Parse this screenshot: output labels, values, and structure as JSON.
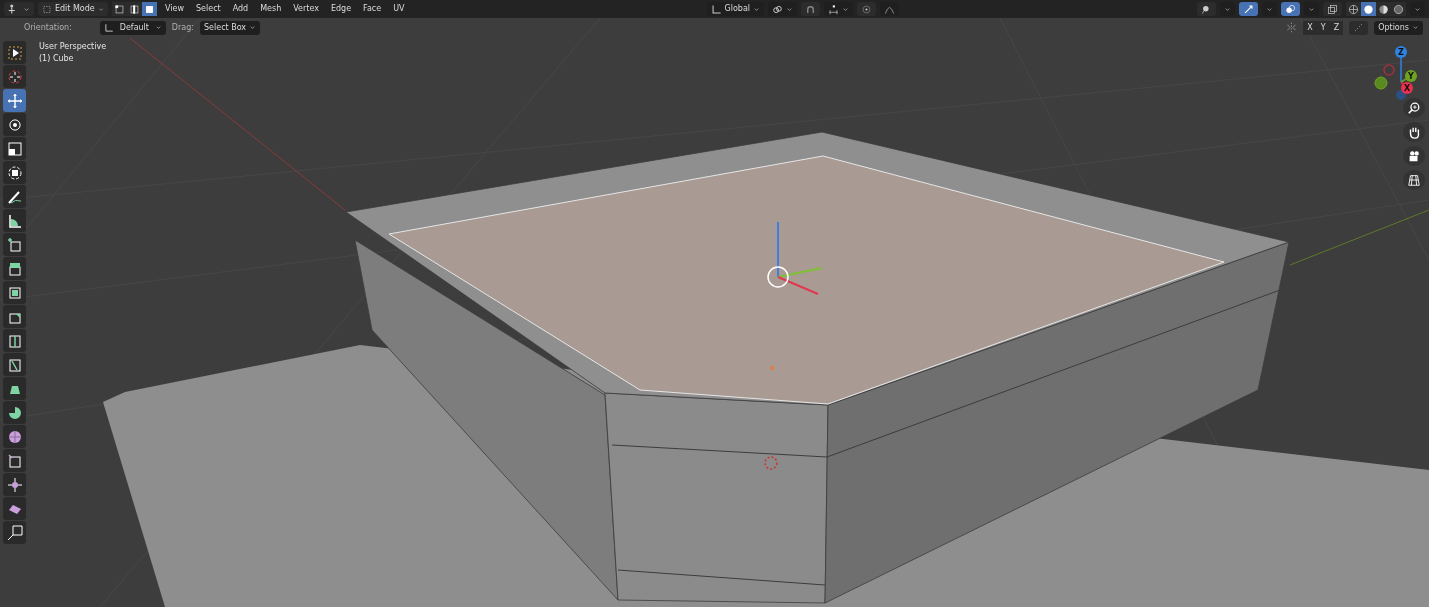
{
  "header": {
    "mode": "Edit Mode",
    "select_modes": [
      {
        "kind": "vertex",
        "selected": false
      },
      {
        "kind": "edge",
        "selected": false
      },
      {
        "kind": "face",
        "selected": true
      }
    ],
    "menus": [
      "View",
      "Select",
      "Add",
      "Mesh",
      "Vertex",
      "Edge",
      "Face",
      "UV"
    ],
    "orientation": "Global",
    "toggles": [
      {
        "kind": "visibility",
        "selected": false
      },
      {
        "kind": "gizmo",
        "selected": true
      },
      {
        "kind": "overlay",
        "selected": true
      },
      {
        "kind": "xray",
        "selected": false
      }
    ],
    "shading_modes": [
      {
        "kind": "wireframe",
        "selected": false
      },
      {
        "kind": "solid",
        "selected": true
      },
      {
        "kind": "material",
        "selected": false
      },
      {
        "kind": "rendered",
        "selected": false
      }
    ]
  },
  "tool_settings": {
    "orientation_label": "Orientation:",
    "orientation": "Default",
    "drag_label": "Drag:",
    "drag": "Select Box",
    "mirror_axes": [
      "X",
      "Y",
      "Z"
    ],
    "options": "Options"
  },
  "viewport": {
    "view_name": "User Perspective",
    "object_name": "(1) Cube"
  },
  "toolbar": [
    {
      "kind": "select",
      "selected": false
    },
    {
      "kind": "cursor",
      "selected": false
    },
    {
      "kind": "move",
      "selected": true
    },
    {
      "kind": "rotate",
      "selected": false
    },
    {
      "kind": "scale",
      "selected": false
    },
    {
      "kind": "transform",
      "selected": false
    },
    {
      "kind": "annotate",
      "selected": false
    },
    {
      "kind": "measure",
      "selected": false
    },
    {
      "kind": "add-cube",
      "selected": false
    },
    {
      "kind": "extrude",
      "selected": false
    },
    {
      "kind": "inset",
      "selected": false
    },
    {
      "kind": "bevel",
      "selected": false
    },
    {
      "kind": "loop-cut",
      "selected": false
    },
    {
      "kind": "knife",
      "selected": false
    },
    {
      "kind": "poly-build",
      "selected": false
    },
    {
      "kind": "spin",
      "selected": false
    },
    {
      "kind": "smooth",
      "selected": false
    },
    {
      "kind": "edge-slide",
      "selected": false
    },
    {
      "kind": "shrink",
      "selected": false
    },
    {
      "kind": "shear",
      "selected": false
    },
    {
      "kind": "rip",
      "selected": false
    }
  ],
  "navigation_gizmo": {
    "axes": [
      {
        "label": "Z",
        "color": "#2f83e3"
      },
      {
        "label": "Y",
        "color": "#6ea31f"
      },
      {
        "label": "X",
        "color": "#e8304f"
      }
    ]
  }
}
